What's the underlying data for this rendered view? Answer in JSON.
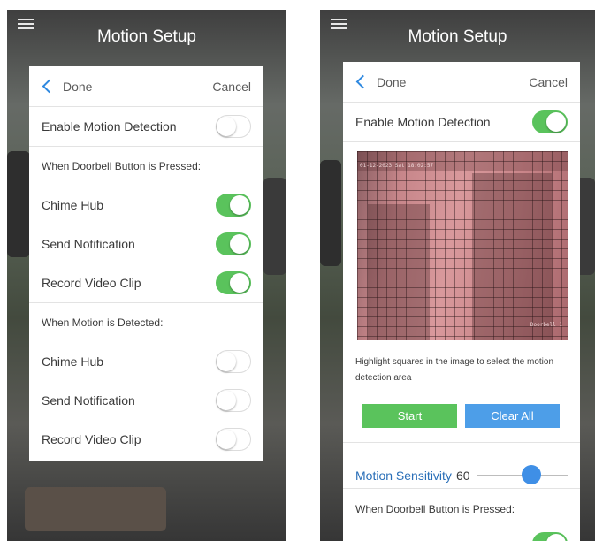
{
  "screen_title": "Motion Setup",
  "header": {
    "done_label": "Done",
    "cancel_label": "Cancel"
  },
  "enable_motion": {
    "label": "Enable Motion Detection"
  },
  "left_panel": {
    "enable_motion_on": false,
    "doorbell_section": {
      "title": "When Doorbell Button is Pressed:",
      "items": [
        {
          "label": "Chime Hub",
          "on": true
        },
        {
          "label": "Send Notification",
          "on": true
        },
        {
          "label": "Record Video Clip",
          "on": true
        }
      ]
    },
    "motion_section": {
      "title": "When Motion is Detected:",
      "items": [
        {
          "label": "Chime Hub",
          "on": false
        },
        {
          "label": "Send Notification",
          "on": false
        },
        {
          "label": "Record Video Clip",
          "on": false
        }
      ]
    }
  },
  "right_panel": {
    "enable_motion_on": true,
    "camera_timestamp": "01-12-2023 Sat 18:02:57",
    "camera_name": "Doorbell 1",
    "hint_text": "Highlight squares in the image to select the motion detection area",
    "start_label": "Start",
    "clear_label": "Clear All",
    "sensitivity_label": "Motion Sensitivity",
    "sensitivity_value": "60",
    "sensitivity_level": 0.6,
    "doorbell_section_title": "When Doorbell Button is Pressed:",
    "doorbell_first_toggle_on": true
  },
  "colors": {
    "toggle_on": "#5ac35c",
    "accent_blue": "#2f89e0",
    "start_button": "#5ac35c",
    "clear_button": "#4d9ee8"
  }
}
